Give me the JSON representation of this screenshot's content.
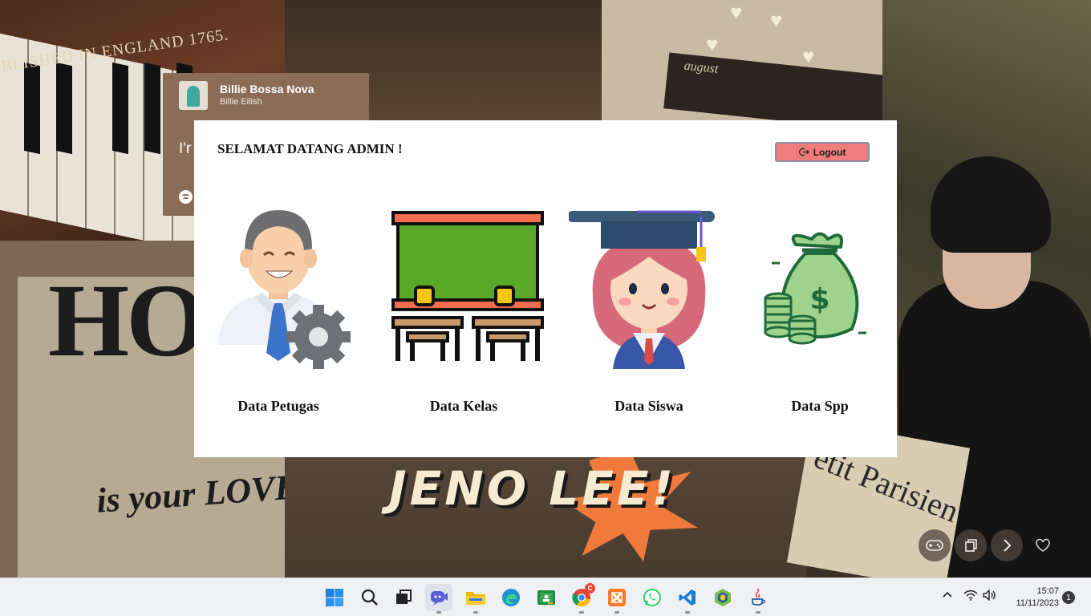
{
  "wallpaper": {
    "piano_text": "BLISHED IN ENGLAND 1765.",
    "book_title": "august",
    "poster_big": "HO DE",
    "poster_small": "is your LOVE",
    "news_text": "etit Parisien",
    "banner_text": "JENO LEE!"
  },
  "media": {
    "title": "Billie Bossa Nova",
    "artist": "Billie Eilish",
    "lyric": "I'r",
    "app_icon": "spotify-icon"
  },
  "floating_buttons": [
    "gamepad-icon",
    "copy-icon",
    "chevron-right-icon",
    "heart-icon"
  ],
  "app": {
    "welcome": "SELAMAT DATANG ADMIN !",
    "logout_label": "Logout",
    "logout_icon": "logout-icon",
    "logout_color": "#f07c7c",
    "cards": [
      {
        "label": "Data Petugas",
        "icon": "officer-icon"
      },
      {
        "label": "Data Kelas",
        "icon": "classroom-icon"
      },
      {
        "label": "Data Siswa",
        "icon": "student-icon"
      },
      {
        "label": "Data Spp",
        "icon": "money-bag-icon"
      }
    ]
  },
  "taskbar": {
    "apps": [
      "start-icon",
      "search-icon",
      "task-view-icon",
      "meet-icon",
      "file-explorer-icon",
      "edge-icon",
      "classroom-app-icon",
      "chrome-icon",
      "xampp-icon",
      "whatsapp-icon",
      "vscode-icon",
      "bluej-icon",
      "java-icon"
    ],
    "chrome_badge": "C",
    "time": "15:07",
    "date": "11/11/2023",
    "notification_count": "1"
  }
}
